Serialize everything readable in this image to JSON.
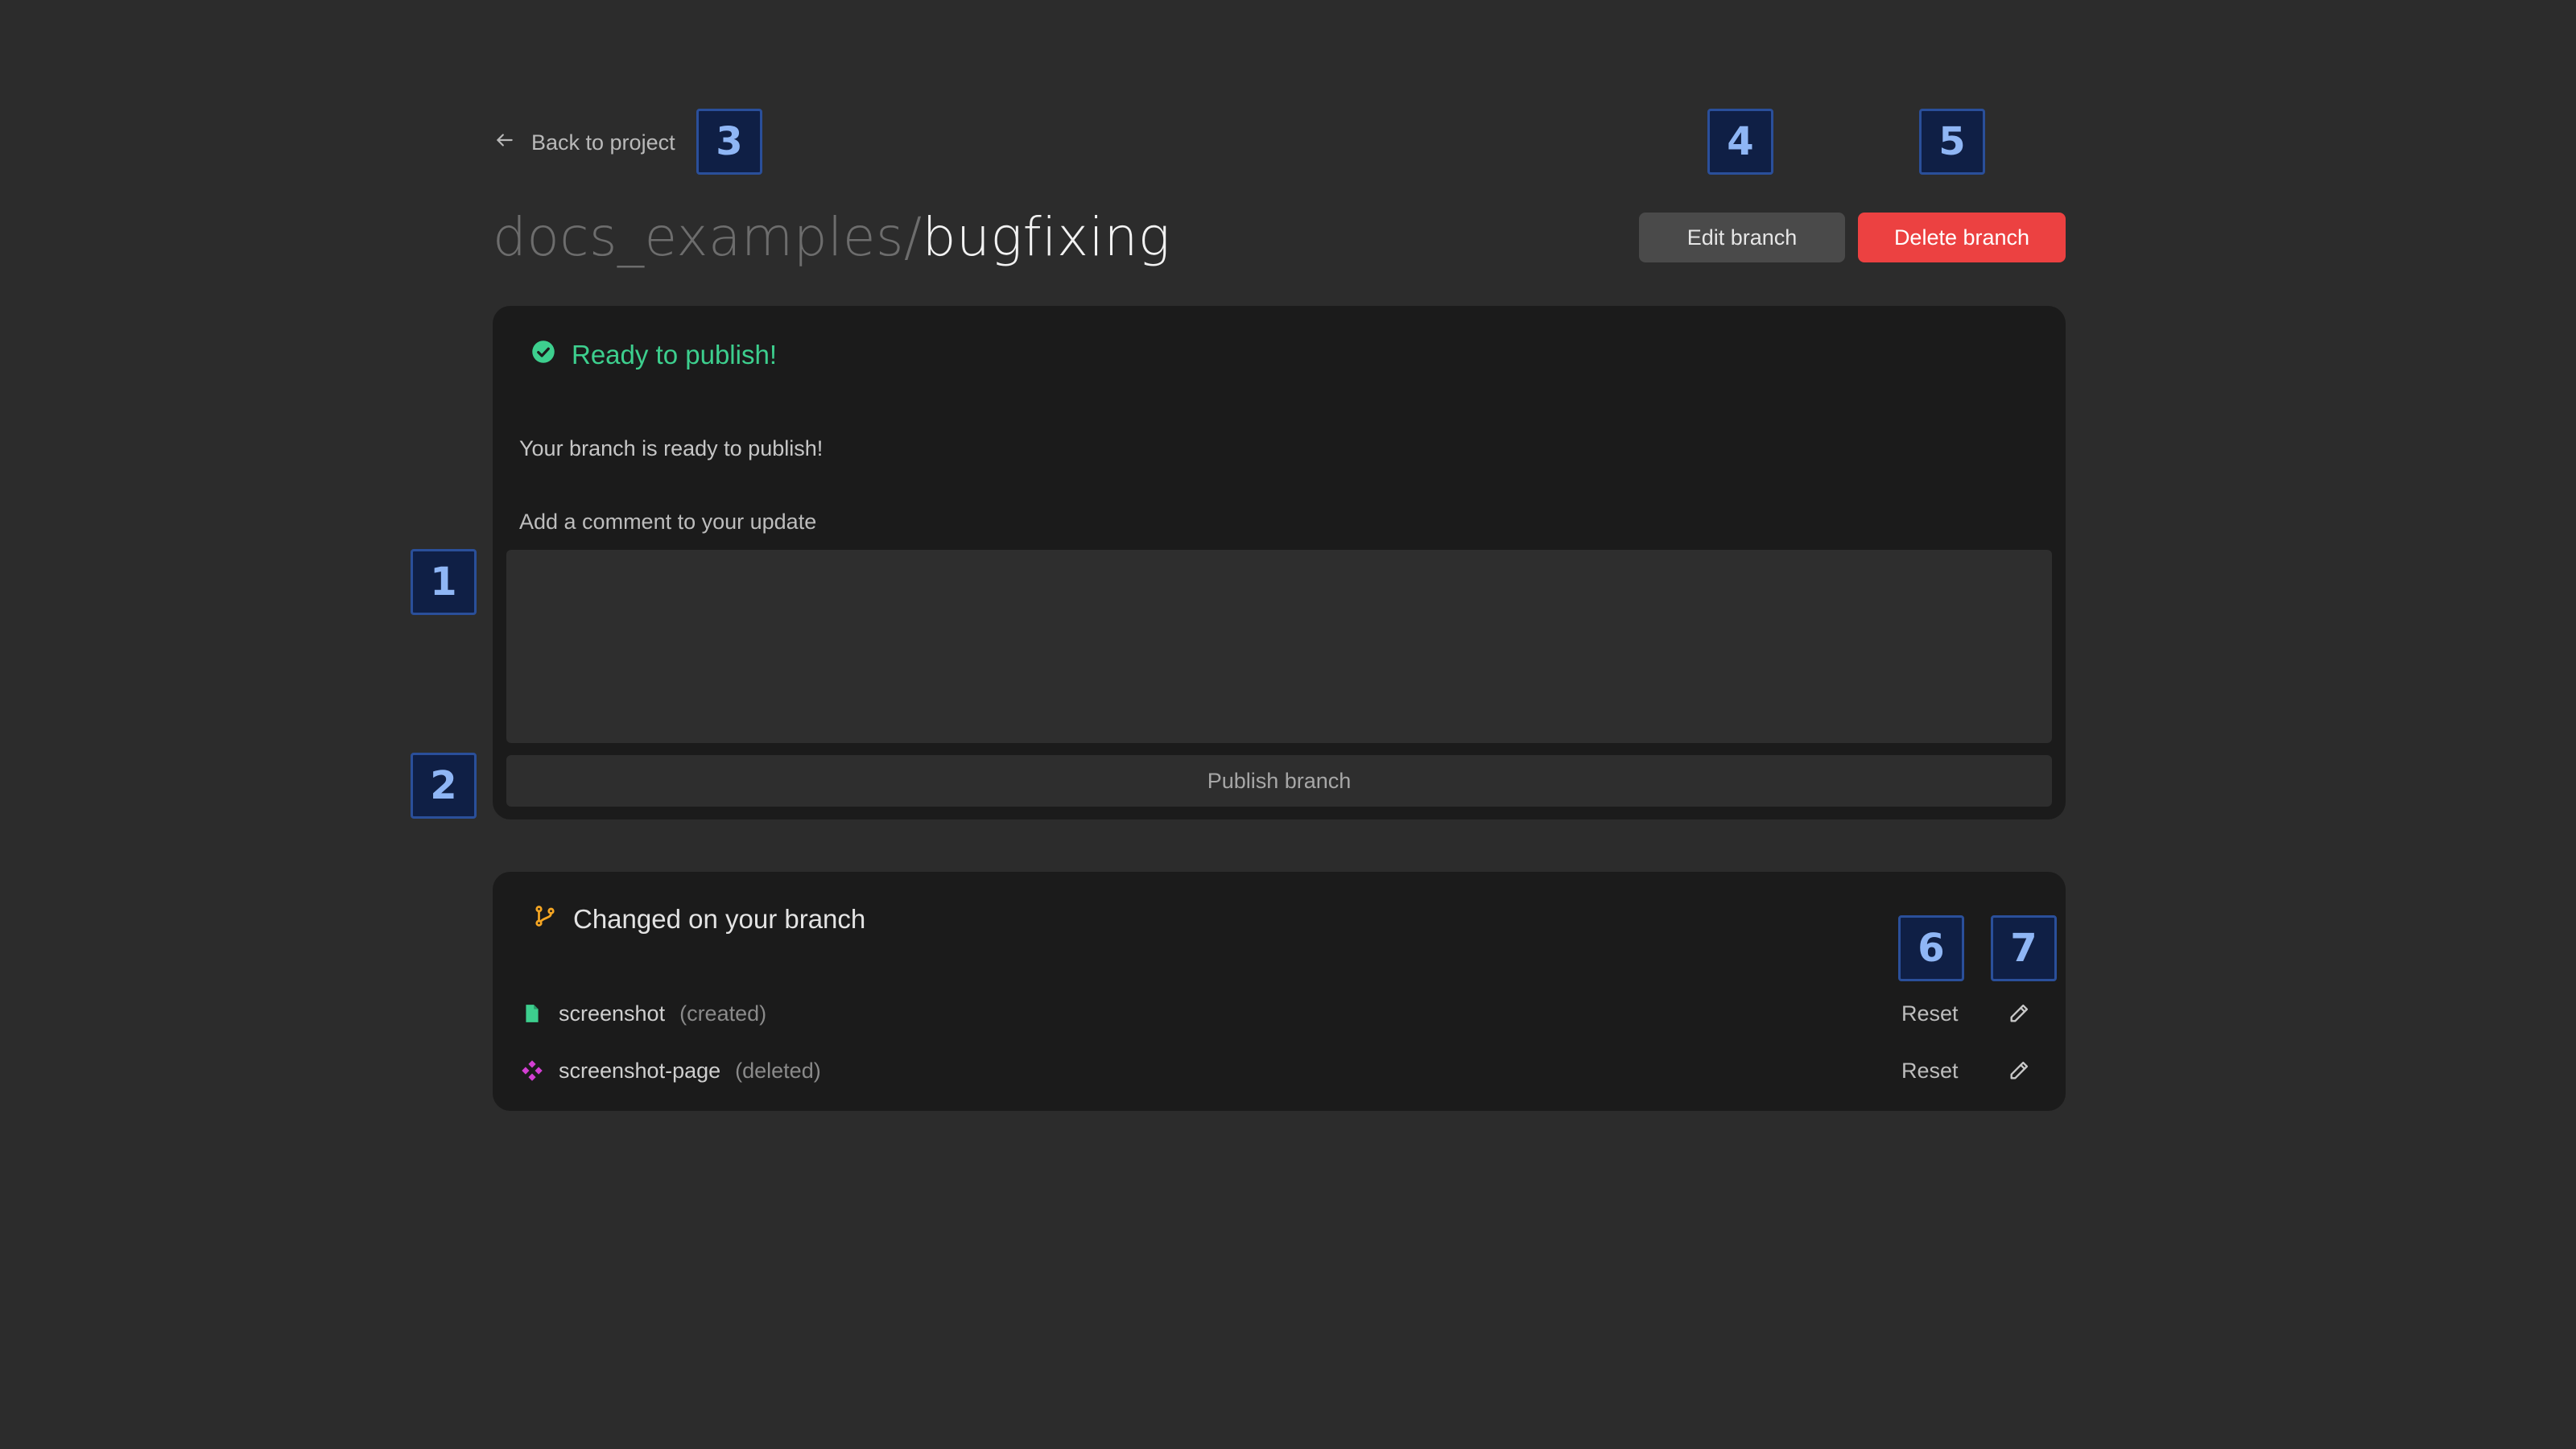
{
  "nav": {
    "back_label": "Back to project"
  },
  "header": {
    "project": "docs_examples/",
    "branch": "bugfixing",
    "edit_label": "Edit branch",
    "delete_label": "Delete branch"
  },
  "publish": {
    "status": "Ready to publish!",
    "message": "Your branch is ready to publish!",
    "comment_label": "Add a comment to your update",
    "comment_value": "",
    "button_label": "Publish branch"
  },
  "changes": {
    "title": "Changed on your branch",
    "items": [
      {
        "name": "screenshot",
        "state": "(created)",
        "icon": "file-icon",
        "reset_label": "Reset"
      },
      {
        "name": "screenshot-page",
        "state": "(deleted)",
        "icon": "component-icon",
        "reset_label": "Reset"
      }
    ]
  },
  "markers": [
    "1",
    "2",
    "3",
    "4",
    "5",
    "6",
    "7"
  ],
  "colors": {
    "background": "#2c2c2c",
    "card": "#1b1b1b",
    "success": "#3dcf8e",
    "danger": "#ec4141",
    "branch_icon": "#f5a623",
    "component_icon": "#d33fd3",
    "marker_bg": "#0f1f45"
  }
}
